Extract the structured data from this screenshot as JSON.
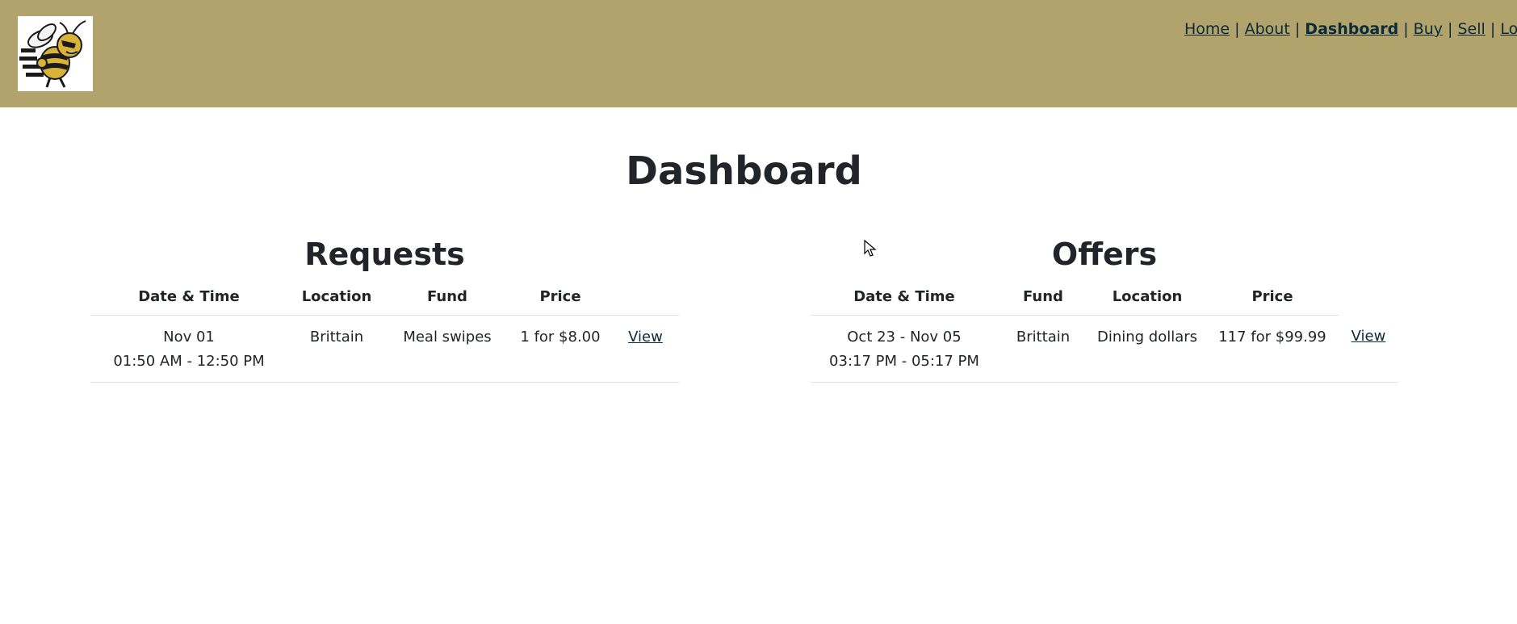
{
  "nav": {
    "links": [
      {
        "label": "Home"
      },
      {
        "label": "About"
      },
      {
        "label": "Dashboard",
        "active": true
      },
      {
        "label": "Buy"
      },
      {
        "label": "Sell"
      },
      {
        "label": "Logout"
      }
    ],
    "separator": "|"
  },
  "page": {
    "title": "Dashboard"
  },
  "requests": {
    "title": "Requests",
    "columns": [
      "Date & Time",
      "Location",
      "Fund",
      "Price"
    ],
    "rows": [
      {
        "date": "Nov 01",
        "time": "01:50 AM - 12:50 PM",
        "location": "Brittain",
        "fund": "Meal swipes",
        "price": "1 for $8.00",
        "action": "View"
      }
    ]
  },
  "offers": {
    "title": "Offers",
    "columns": [
      "Date & Time",
      "Fund",
      "Location",
      "Price"
    ],
    "rows": [
      {
        "date": "Oct 23 - Nov 05",
        "time": "03:17 PM - 05:17 PM",
        "fund": "Brittain",
        "location": "Dining dollars",
        "price": "117 for $99.99",
        "action": "View"
      }
    ]
  },
  "colors": {
    "header": "#b1a36b",
    "link": "#0c2b3a",
    "text": "#212529",
    "divider": "#dee2e6"
  },
  "icons": {
    "logo": "yellow-jacket-logo-icon",
    "cursor": "mouse-pointer-icon"
  }
}
